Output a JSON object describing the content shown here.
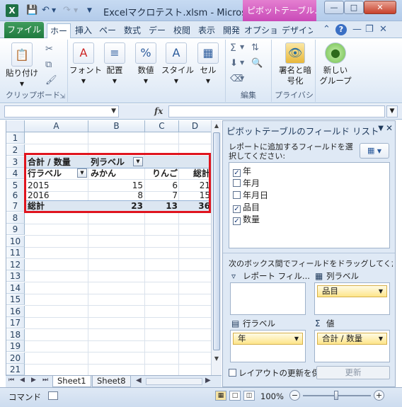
{
  "window": {
    "title": "Excelマクロテスト.xlsm - Micros...",
    "context_tab": "ピボットテーブル..."
  },
  "ribbon": {
    "tabs": [
      "ファイル",
      "ホー",
      "挿入",
      "ペー",
      "数式",
      "デー",
      "校閲",
      "表示",
      "開発",
      "オプション",
      "デザイン"
    ],
    "groups": {
      "clipboard": {
        "paste": "貼り付け",
        "label": "クリップボード"
      },
      "font": "フォント",
      "alignment": "配置",
      "number": "数値",
      "styles": "スタイル",
      "cells": "セル",
      "editing": "編集",
      "privacy": {
        "sign_encrypt_1": "署名と暗",
        "sign_encrypt_2": "号化",
        "label": "プライバシ"
      },
      "new_group_1": "新しい",
      "new_group_2": "グループ"
    }
  },
  "formula_bar": {
    "fx": "fx",
    "name_box": "",
    "content": ""
  },
  "grid": {
    "columns": [
      "A",
      "B",
      "C",
      "D"
    ],
    "rows": [
      "1",
      "2",
      "3",
      "4",
      "5",
      "6",
      "7",
      "8",
      "9",
      "10",
      "11",
      "12",
      "13",
      "14",
      "15",
      "16",
      "17",
      "18",
      "19",
      "20",
      "21"
    ],
    "pivot": {
      "r3": {
        "a": "合計 / 数量",
        "b": "列ラベル"
      },
      "r4": {
        "a": "行ラベル",
        "b": "みかん",
        "c": "りんご",
        "d": "総計"
      },
      "r5": {
        "a": "2015",
        "b": "15",
        "c": "6",
        "d": "21"
      },
      "r6": {
        "a": "2016",
        "b": "8",
        "c": "7",
        "d": "15"
      },
      "r7": {
        "a": "総計",
        "b": "23",
        "c": "13",
        "d": "36"
      }
    }
  },
  "sheets": [
    "Sheet1",
    "Sheet8"
  ],
  "field_list": {
    "title": "ピボットテーブルのフィールド リスト",
    "instruction": "レポートに追加するフィールドを選択してください:",
    "fields": [
      {
        "name": "年",
        "checked": true
      },
      {
        "name": "年月",
        "checked": false
      },
      {
        "name": "年月日",
        "checked": false
      },
      {
        "name": "品目",
        "checked": true
      },
      {
        "name": "数量",
        "checked": true
      }
    ],
    "drag_instruction": "次のボックス間でフィールドをドラッグしてください:",
    "areas": {
      "filter": {
        "label": "レポート フィル...",
        "item": ""
      },
      "columns": {
        "label": "列ラベル",
        "item": "品目"
      },
      "rows": {
        "label": "行ラベル",
        "item": "年"
      },
      "values": {
        "label": "値",
        "item": "合計 / 数量"
      }
    },
    "defer": "レイアウトの更新を保...",
    "update": "更新"
  },
  "status": {
    "mode": "コマンド",
    "zoom": "100%"
  }
}
